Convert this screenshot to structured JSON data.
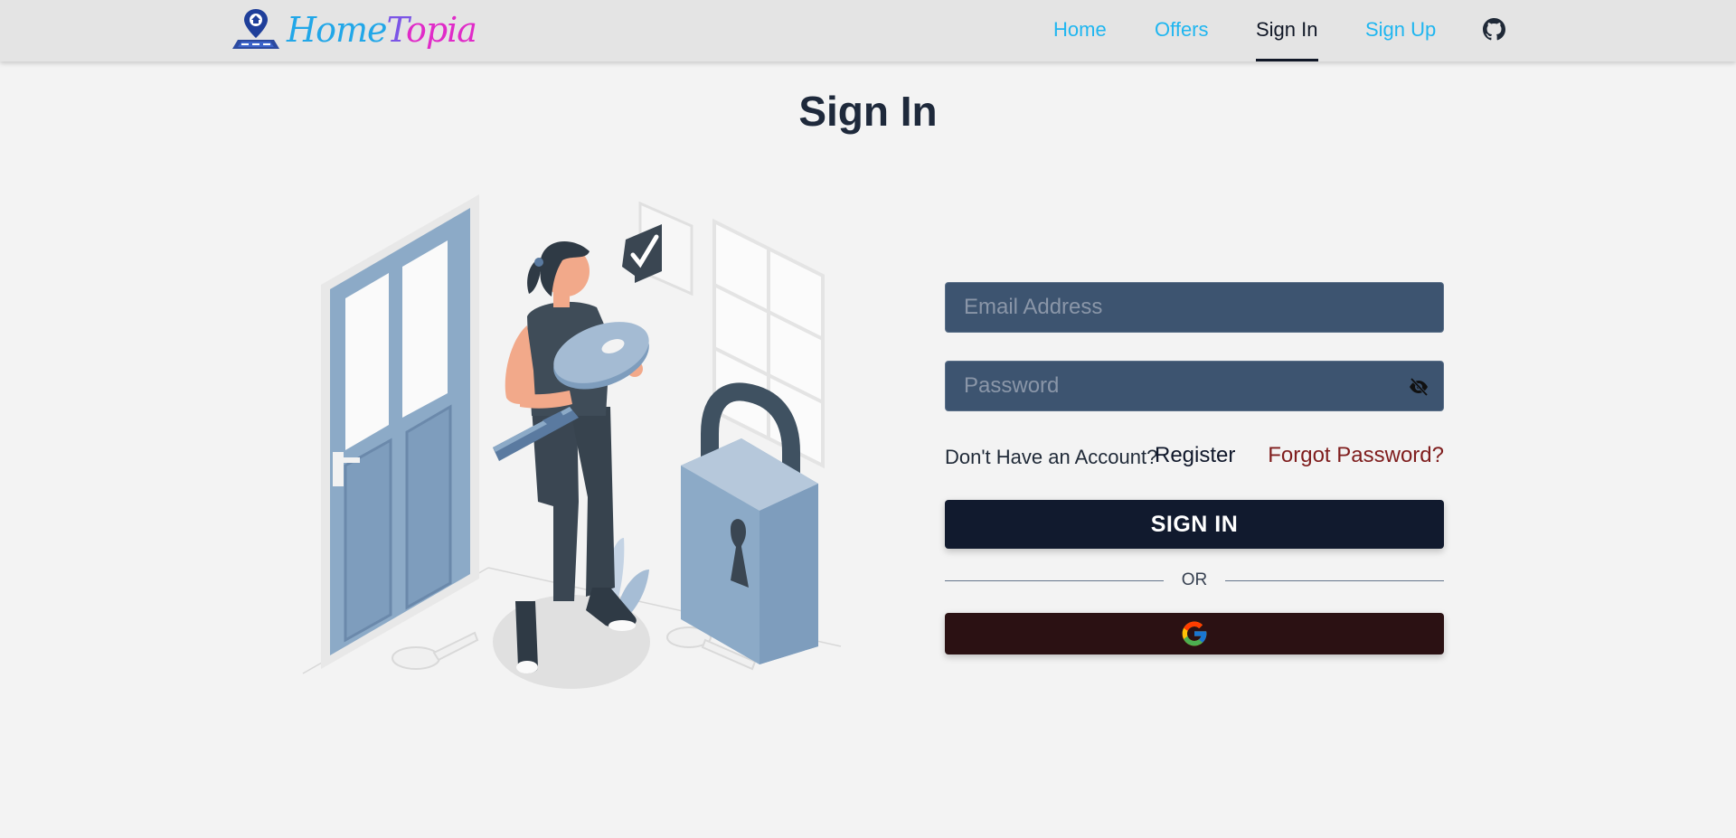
{
  "header": {
    "logo": {
      "parts": [
        "Home",
        "T",
        "opia"
      ]
    },
    "nav": [
      {
        "label": "Home"
      },
      {
        "label": "Offers"
      },
      {
        "label": "Sign In",
        "active": true
      },
      {
        "label": "Sign Up"
      }
    ],
    "github_icon": "github-icon"
  },
  "page": {
    "title": "Sign In"
  },
  "illustration": {
    "icon": "woman-holding-key-with-padlock-and-door"
  },
  "form": {
    "email_placeholder": "Email Address",
    "email_value": "",
    "password_placeholder": "Password",
    "password_value": "",
    "password_toggle_icon": "eye-slash-icon",
    "no_account_text": "Don't Have an Account?",
    "register_label": "Register",
    "forgot_label": "Forgot Password?",
    "signin_label": "SIGN IN",
    "or_label": "OR",
    "google_icon": "google-icon"
  },
  "colors": {
    "header_bg": "#e4e4e4",
    "page_bg": "#f3f3f3",
    "nav_link": "#1fb6f0",
    "nav_active": "#111827",
    "input_bg": "#3d5470",
    "signin_bg": "#111a2e",
    "google_bg": "#2b1113",
    "forgot": "#7f1d1d"
  }
}
